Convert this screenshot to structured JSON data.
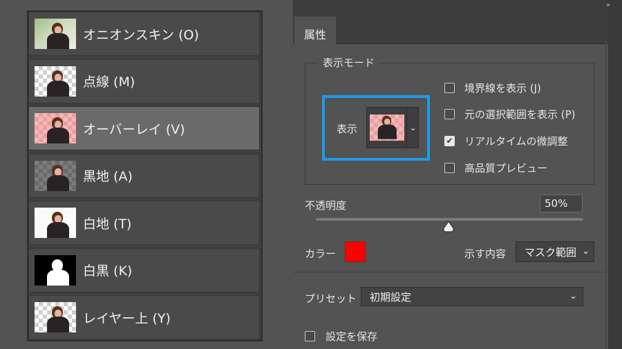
{
  "view_modes": {
    "items": [
      {
        "label": "オニオンスキン (O)",
        "thumb": "onion"
      },
      {
        "label": "点線 (M)",
        "thumb": "check"
      },
      {
        "label": "オーバーレイ (V)",
        "thumb": "overlay",
        "selected": true
      },
      {
        "label": "黒地 (A)",
        "thumb": "black"
      },
      {
        "label": "白地 (T)",
        "thumb": "white"
      },
      {
        "label": "白黒 (K)",
        "thumb": "bw"
      },
      {
        "label": "レイヤー上 (Y)",
        "thumb": "check"
      }
    ]
  },
  "properties": {
    "tab_label": "属性",
    "view_mode_group": {
      "legend": "表示モード",
      "display_label": "表示",
      "options": [
        {
          "label": "境界線を表示 (J)",
          "checked": false
        },
        {
          "label": "元の選択範囲を表示 (P)",
          "checked": false
        },
        {
          "label": "リアルタイムの微調整",
          "checked": true
        },
        {
          "label": "高品質プレビュー",
          "checked": false
        }
      ]
    },
    "opacity": {
      "label": "不透明度",
      "value": "50%",
      "level": 50
    },
    "color": {
      "label": "カラー",
      "value": "#ff0000"
    },
    "show": {
      "label": "示す内容",
      "value": "マスク範囲"
    },
    "preset": {
      "label": "プリセット",
      "value": "初期設定"
    },
    "save_settings": {
      "label": "設定を保存",
      "checked": false
    }
  }
}
